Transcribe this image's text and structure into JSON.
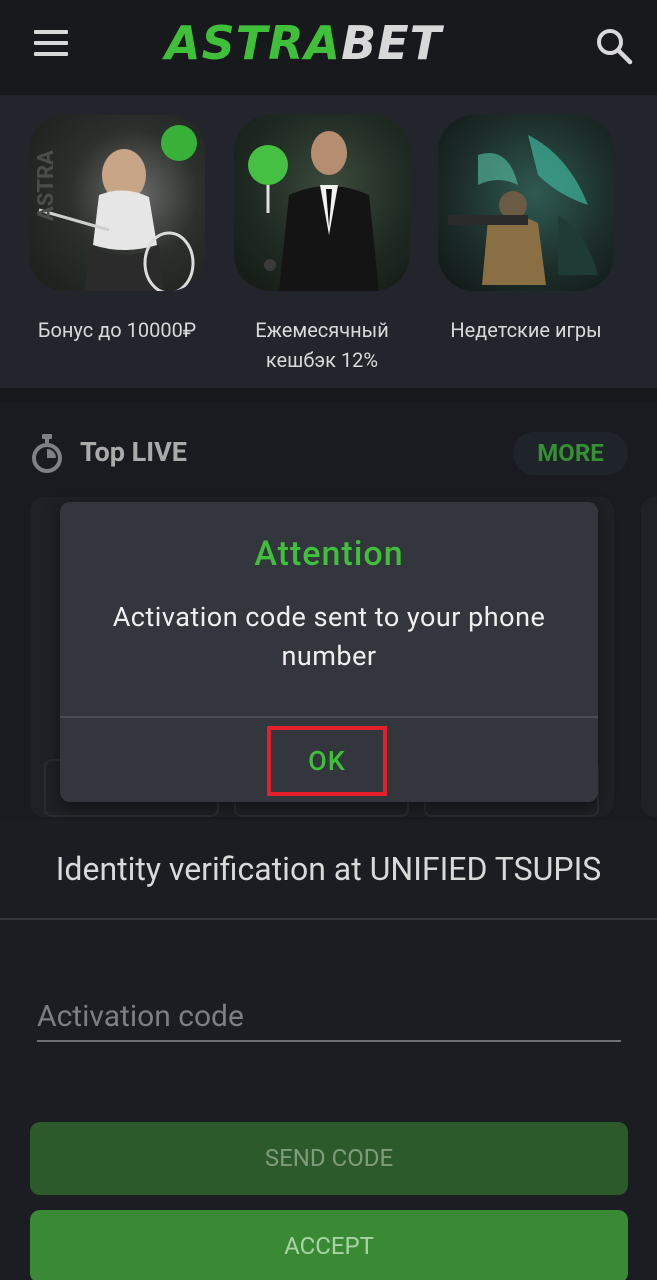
{
  "header": {
    "logo_part1": "ASTRA",
    "logo_part2": "BET",
    "menu_icon": "hamburger-menu-icon",
    "search_icon": "search-icon"
  },
  "promos": [
    {
      "caption": "Бонус до 10000₽"
    },
    {
      "caption": "Ежемесячный кешбэк 12%"
    },
    {
      "caption": "Недетские игры"
    }
  ],
  "top_live": {
    "title": "Top LIVE",
    "more_label": "MORE",
    "icon": "stopwatch-icon"
  },
  "dialog": {
    "title": "Attention",
    "message": "Activation code sent to your phone number",
    "ok_label": "OK"
  },
  "verification": {
    "title": "Identity verification at UNIFIED TSUPIS",
    "code_placeholder": "Activation code",
    "send_code_label": "SEND CODE",
    "accept_label": "ACCEPT"
  },
  "colors": {
    "accent_green": "#3fbf3a",
    "background": "#1b1d22",
    "highlight_red": "#e5202a"
  }
}
